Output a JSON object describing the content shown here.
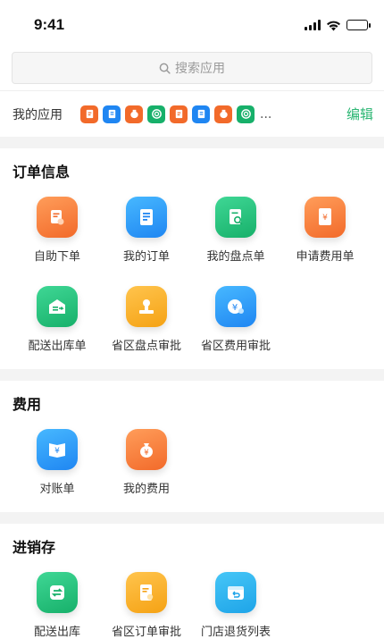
{
  "status_bar": {
    "time": "9:41"
  },
  "search": {
    "placeholder": "搜索应用"
  },
  "my_apps": {
    "label": "我的应用",
    "ellipsis": "...",
    "edit": "编辑",
    "icons": [
      "order-icon",
      "list-icon",
      "money-bag-icon",
      "swirl-icon",
      "order-icon",
      "list-icon",
      "money-bag-icon",
      "swirl-icon"
    ]
  },
  "sections": [
    {
      "title": "订单信息",
      "apps": [
        {
          "label": "自助下单",
          "icon": "self-order-icon",
          "color": "#f26a2a"
        },
        {
          "label": "我的订单",
          "icon": "order-list-icon",
          "color": "#1f86f2"
        },
        {
          "label": "我的盘点单",
          "icon": "inventory-check-icon",
          "color": "#17b06a"
        },
        {
          "label": "申请费用单",
          "icon": "expense-request-icon",
          "color": "#f26a2a"
        },
        {
          "label": "配送出库单",
          "icon": "delivery-out-icon",
          "color": "#17b06a"
        },
        {
          "label": "省区盘点审批",
          "icon": "stamp-icon",
          "color": "#f5a214"
        },
        {
          "label": "省区费用审批",
          "icon": "fee-approval-icon",
          "color": "#1f86f2"
        }
      ]
    },
    {
      "title": "费用",
      "apps": [
        {
          "label": "对账单",
          "icon": "ledger-icon",
          "color": "#1f86f2"
        },
        {
          "label": "我的费用",
          "icon": "money-bag-icon",
          "color": "#f26a2a"
        }
      ]
    },
    {
      "title": "进销存",
      "apps": [
        {
          "label": "配送出库",
          "icon": "transfer-icon",
          "color": "#17b06a"
        },
        {
          "label": "省区订单审批",
          "icon": "order-approval-icon",
          "color": "#f5a214"
        },
        {
          "label": "门店退货列表",
          "icon": "return-box-icon",
          "color": "#1ea4e8"
        }
      ]
    }
  ]
}
